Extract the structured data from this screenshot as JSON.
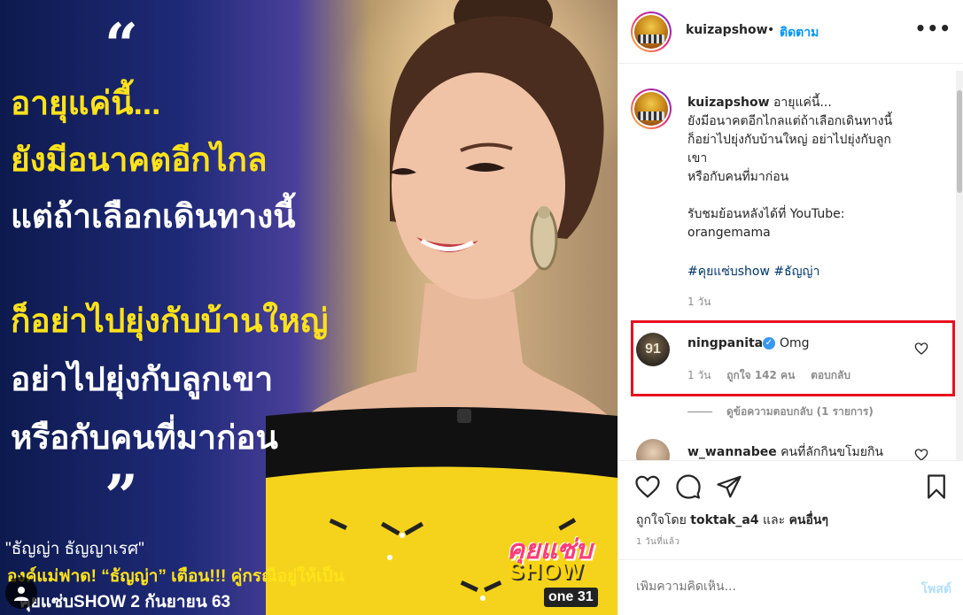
{
  "post_image": {
    "quote_open": "“",
    "quote_close": "”",
    "headline": [
      "อายุแค่นี้...",
      "ยังมีอนาคตอีกไกล",
      "แต่ถ้าเลือกเดินทางนี้",
      "ก็อย่าไปยุ่งกับบ้านใหญ่",
      "อย่าไปยุ่งกับลูกเขา",
      "หรือกับคนที่มาก่อน"
    ],
    "caption_name": "\"ธัญญ่า ธัญญาเรศ\"",
    "caption_sub": "องค์แม่ฟาด! “ธัญญ่า” เตือน!!! คู่กรณีอยู่ให้เป็น",
    "caption_date": "คุยแซ่บSHOW 2 กันยายน 63",
    "logo_top": "คุยแซ่บ",
    "logo_bottom": "SHOW",
    "channel": "one 31"
  },
  "header": {
    "username": "kuizapshow",
    "separator": "•",
    "follow_label": "ติดตาม",
    "more_label": "•••"
  },
  "caption": {
    "username": "kuizapshow",
    "lines": [
      "อายุแค่นี้...",
      "ยังมีอนาคตอีกไกลแต่ถ้าเลือกเดินทางนี้",
      "ก็อย่าไปยุ่งกับบ้านใหญ่ อย่าไปยุ่งกับลูก",
      "เขา",
      "หรือกับคนที่มาก่อน",
      "",
      "รับชมย้อนหลังได้ที่ YouTube:",
      "orangemama"
    ],
    "hashtags": "#คุยแซ่บshow #ธัญญ่า",
    "time": "1 วัน"
  },
  "comments": [
    {
      "username": "ningpanita",
      "verified": true,
      "text": "Omg",
      "avatar_text": "91",
      "time": "1 วัน",
      "likes": "ถูกใจ 142 คน",
      "reply": "ตอบกลับ",
      "view_replies": "ดูข้อความตอบกลับ (1 รายการ)"
    },
    {
      "username": "w_wannabee",
      "text": "คนที่ลักกินขโมยกิน"
    }
  ],
  "actions": {
    "liked_by_prefix": "ถูกใจโดย",
    "liked_by_user": "toktak_a4",
    "liked_by_and": "และ",
    "liked_by_others": "คนอื่นๆ",
    "post_time": "1 วันที่แล้ว"
  },
  "add_comment": {
    "placeholder": "เพิ่มความคิดเห็น...",
    "post_label": "โพสต์"
  },
  "colors": {
    "link_blue": "#0095f6",
    "hashtag": "#00376b",
    "highlight_box": "#e8101f",
    "headline_yellow": "#ffe21a",
    "post_disabled": "#b2dffc"
  }
}
